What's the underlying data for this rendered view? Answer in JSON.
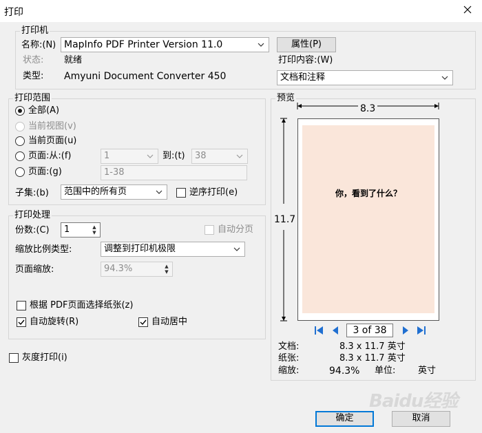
{
  "window": {
    "title": "打印"
  },
  "printer": {
    "group_label": "打印机",
    "name_label": "名称:(N)",
    "name_value": "MapInfo PDF Printer Version 11.0",
    "properties_button": "属性(P)",
    "status_label": "状态:",
    "status_value": "就绪",
    "type_label": "类型:",
    "type_value": "Amyuni Document Converter 450",
    "content_label": "打印内容:(W)",
    "content_value": "文档和注释"
  },
  "range": {
    "group_label": "打印范围",
    "all": "全部(A)",
    "current_view": "当前视图(v)",
    "current_page": "当前页面(u)",
    "pages_from": "页面:从:(f)",
    "from_value": "1",
    "to_label": "到:(t)",
    "to_value": "38",
    "pages": "页面:(g)",
    "pages_value": "1-38",
    "subset_label": "子集:(b)",
    "subset_value": "范围中的所有页",
    "reverse": "逆序打印(e)"
  },
  "handling": {
    "group_label": "打印处理",
    "copies_label": "份数:(C)",
    "copies_value": "1",
    "collate": "自动分页",
    "scaling_label": "缩放比例类型:",
    "scaling_value": "调整到打印机极限",
    "zoom_label": "页面缩放:",
    "zoom_value": "94.3%",
    "choose_paper": "根据 PDF页面选择纸张(z)",
    "auto_rotate": "自动旋转(R)",
    "auto_center": "自动居中"
  },
  "grayscale": "灰度打印(i)",
  "preview": {
    "label": "预览",
    "width": "8.3",
    "height": "11.7",
    "page_text": "你，看到了什么？",
    "page_indicator": "3 of 38",
    "doc_label": "文档:",
    "doc_value": "8.3 x 11.7 英寸",
    "paper_label": "纸张:",
    "paper_value": "8.3 x 11.7 英寸",
    "scale_label": "缩放:",
    "scale_value": "94.3%",
    "unit_label": "单位:",
    "unit_value": "英寸"
  },
  "buttons": {
    "ok": "确定",
    "cancel": "取消"
  },
  "watermark": "Baidu经验",
  "colors": {
    "accent": "#0078d7",
    "nav": "#1f6fd1",
    "paper": "#fae6da"
  }
}
